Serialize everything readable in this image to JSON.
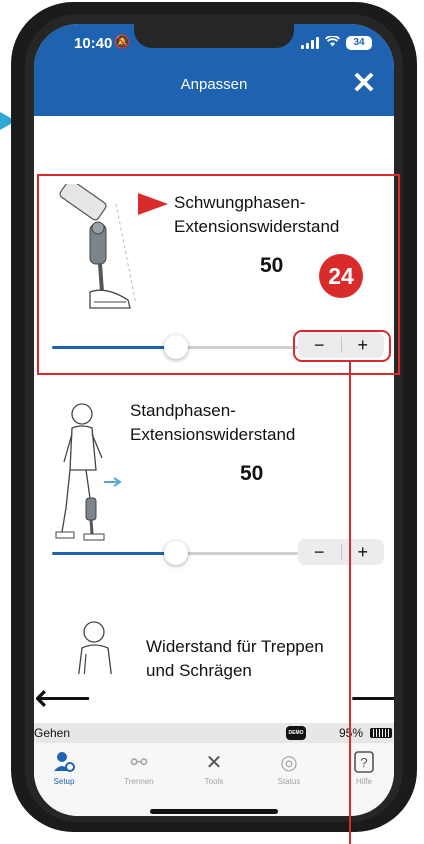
{
  "status_bar": {
    "time": "10:40",
    "battery_level": "34"
  },
  "header": {
    "title": "Anpassen",
    "close_symbol": "✕"
  },
  "settings": [
    {
      "title_line1": "Schwungphasen-",
      "title_line2": "Extensionswiderstand",
      "value": "50",
      "slider_fraction": 0.5,
      "stepper_minus": "−",
      "stepper_plus": "+",
      "illustration_icon": "prosthetic-knee-swing-icon"
    },
    {
      "title_line1": "Standphasen-",
      "title_line2": "Extensionswiderstand",
      "value": "50",
      "slider_fraction": 0.5,
      "stepper_minus": "−",
      "stepper_plus": "+",
      "illustration_icon": "walking-person-prosthesis-icon"
    },
    {
      "title_line1": "Widerstand für Treppen",
      "title_line2": "und Schrägen",
      "illustration_icon": "person-stairs-icon"
    }
  ],
  "navigation": {
    "prev_symbol": "⟵",
    "next_symbol": "⟶"
  },
  "mode_bar": {
    "mode": "Gehen",
    "demo_badge": "DEMO",
    "battery_percent": "95%"
  },
  "tabs": [
    {
      "label": "Setup",
      "icon": "person-gear-icon",
      "active": true
    },
    {
      "label": "Trennen",
      "icon": "unlink-icon",
      "active": false
    },
    {
      "label": "Tools",
      "icon": "tools-icon",
      "active": false
    },
    {
      "label": "Status",
      "icon": "status-gauge-icon",
      "active": false
    },
    {
      "label": "Hilfe",
      "icon": "help-icon",
      "active": false
    }
  ],
  "annotation": {
    "callout_number": "24"
  },
  "colors": {
    "brand_blue": "#1e62b0",
    "annotation_red": "#d92b2b",
    "external_pointer": "#2ea7d8"
  }
}
